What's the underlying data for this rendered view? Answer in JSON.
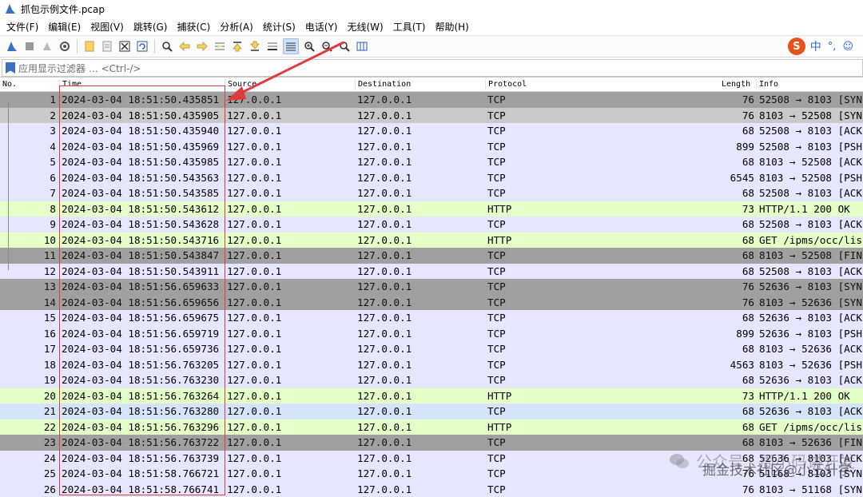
{
  "window": {
    "title": "抓包示例文件.pcap"
  },
  "menu": [
    "文件(F)",
    "编辑(E)",
    "视图(V)",
    "跳转(G)",
    "捕获(C)",
    "分析(A)",
    "统计(S)",
    "电话(Y)",
    "无线(W)",
    "工具(T)",
    "帮助(H)"
  ],
  "toolbar": {
    "icons": [
      "shark-fin-icon",
      "stop-icon",
      "restart-icon",
      "options-icon",
      "open-icon",
      "save-icon",
      "close-icon",
      "reload-icon",
      "find-icon",
      "back-icon",
      "forward-icon",
      "go-to-icon",
      "first-icon",
      "last-icon",
      "autoscroll-icon",
      "colorize-icon",
      "zoom-in-icon",
      "zoom-out-icon",
      "zoom-normal-icon",
      "resize-columns-icon"
    ]
  },
  "ime": {
    "logo": "S",
    "lang": "中",
    "punct": "°,",
    "emoji": "☺"
  },
  "filter": {
    "placeholder": "应用显示过滤器 … <Ctrl-/>"
  },
  "columns": {
    "no": "No.",
    "time": "Time",
    "source": "Source",
    "destination": "Destination",
    "protocol": "Protocol",
    "length": "Length",
    "info": "Info"
  },
  "packets": [
    {
      "no": "1",
      "time": "2024-03-04 18:51:50.435851",
      "src": "127.0.0.1",
      "dst": "127.0.0.1",
      "proto": "TCP",
      "len": "76",
      "info": "52508 → 8103 [SYN"
    },
    {
      "no": "2",
      "time": "2024-03-04 18:51:50.435905",
      "src": "127.0.0.1",
      "dst": "127.0.0.1",
      "proto": "TCP",
      "len": "76",
      "info": "8103 → 52508 [SYN"
    },
    {
      "no": "3",
      "time": "2024-03-04 18:51:50.435940",
      "src": "127.0.0.1",
      "dst": "127.0.0.1",
      "proto": "TCP",
      "len": "68",
      "info": "52508 → 8103 [ACK"
    },
    {
      "no": "4",
      "time": "2024-03-04 18:51:50.435969",
      "src": "127.0.0.1",
      "dst": "127.0.0.1",
      "proto": "TCP",
      "len": "899",
      "info": "52508 → 8103 [PSH"
    },
    {
      "no": "5",
      "time": "2024-03-04 18:51:50.435985",
      "src": "127.0.0.1",
      "dst": "127.0.0.1",
      "proto": "TCP",
      "len": "68",
      "info": "8103 → 52508 [ACK"
    },
    {
      "no": "6",
      "time": "2024-03-04 18:51:50.543563",
      "src": "127.0.0.1",
      "dst": "127.0.0.1",
      "proto": "TCP",
      "len": "6545",
      "info": "8103 → 52508 [PSH"
    },
    {
      "no": "7",
      "time": "2024-03-04 18:51:50.543585",
      "src": "127.0.0.1",
      "dst": "127.0.0.1",
      "proto": "TCP",
      "len": "68",
      "info": "52508 → 8103 [ACK"
    },
    {
      "no": "8",
      "time": "2024-03-04 18:51:50.543612",
      "src": "127.0.0.1",
      "dst": "127.0.0.1",
      "proto": "HTTP",
      "len": "73",
      "info": "HTTP/1.1 200 OK"
    },
    {
      "no": "9",
      "time": "2024-03-04 18:51:50.543628",
      "src": "127.0.0.1",
      "dst": "127.0.0.1",
      "proto": "TCP",
      "len": "68",
      "info": "52508 → 8103 [ACK"
    },
    {
      "no": "10",
      "time": "2024-03-04 18:51:50.543716",
      "src": "127.0.0.1",
      "dst": "127.0.0.1",
      "proto": "HTTP",
      "len": "68",
      "info": "GET /ipms/occ/lis"
    },
    {
      "no": "11",
      "time": "2024-03-04 18:51:50.543847",
      "src": "127.0.0.1",
      "dst": "127.0.0.1",
      "proto": "TCP",
      "len": "68",
      "info": "8103 → 52508 [FIN"
    },
    {
      "no": "12",
      "time": "2024-03-04 18:51:50.543911",
      "src": "127.0.0.1",
      "dst": "127.0.0.1",
      "proto": "TCP",
      "len": "68",
      "info": "52508 → 8103 [ACK"
    },
    {
      "no": "13",
      "time": "2024-03-04 18:51:56.659633",
      "src": "127.0.0.1",
      "dst": "127.0.0.1",
      "proto": "TCP",
      "len": "76",
      "info": "52636 → 8103 [SYN"
    },
    {
      "no": "14",
      "time": "2024-03-04 18:51:56.659656",
      "src": "127.0.0.1",
      "dst": "127.0.0.1",
      "proto": "TCP",
      "len": "76",
      "info": "8103 → 52636 [SYN"
    },
    {
      "no": "15",
      "time": "2024-03-04 18:51:56.659675",
      "src": "127.0.0.1",
      "dst": "127.0.0.1",
      "proto": "TCP",
      "len": "68",
      "info": "52636 → 8103 [ACK"
    },
    {
      "no": "16",
      "time": "2024-03-04 18:51:56.659719",
      "src": "127.0.0.1",
      "dst": "127.0.0.1",
      "proto": "TCP",
      "len": "899",
      "info": "52636 → 8103 [PSH"
    },
    {
      "no": "17",
      "time": "2024-03-04 18:51:56.659736",
      "src": "127.0.0.1",
      "dst": "127.0.0.1",
      "proto": "TCP",
      "len": "68",
      "info": "8103 → 52636 [ACK"
    },
    {
      "no": "18",
      "time": "2024-03-04 18:51:56.763205",
      "src": "127.0.0.1",
      "dst": "127.0.0.1",
      "proto": "TCP",
      "len": "4563",
      "info": "8103 → 52636 [PSH"
    },
    {
      "no": "19",
      "time": "2024-03-04 18:51:56.763230",
      "src": "127.0.0.1",
      "dst": "127.0.0.1",
      "proto": "TCP",
      "len": "68",
      "info": "52636 → 8103 [ACK"
    },
    {
      "no": "20",
      "time": "2024-03-04 18:51:56.763264",
      "src": "127.0.0.1",
      "dst": "127.0.0.1",
      "proto": "HTTP",
      "len": "73",
      "info": "HTTP/1.1 200 OK"
    },
    {
      "no": "21",
      "time": "2024-03-04 18:51:56.763280",
      "src": "127.0.0.1",
      "dst": "127.0.0.1",
      "proto": "TCP",
      "len": "68",
      "info": "52636 → 8103 [ACK"
    },
    {
      "no": "22",
      "time": "2024-03-04 18:51:56.763296",
      "src": "127.0.0.1",
      "dst": "127.0.0.1",
      "proto": "HTTP",
      "len": "68",
      "info": "GET /ipms/occ/lis"
    },
    {
      "no": "23",
      "time": "2024-03-04 18:51:56.763722",
      "src": "127.0.0.1",
      "dst": "127.0.0.1",
      "proto": "TCP",
      "len": "68",
      "info": "8103 → 52636 [FIN"
    },
    {
      "no": "24",
      "time": "2024-03-04 18:51:56.763739",
      "src": "127.0.0.1",
      "dst": "127.0.0.1",
      "proto": "TCP",
      "len": "68",
      "info": "52636 → 8103 [ACK"
    },
    {
      "no": "25",
      "time": "2024-03-04 18:51:58.766721",
      "src": "127.0.0.1",
      "dst": "127.0.0.1",
      "proto": "TCP",
      "len": "76",
      "info": "51168 → 8103 [SYN"
    },
    {
      "no": "26",
      "time": "2024-03-04 18:51:58.766741",
      "src": "127.0.0.1",
      "dst": "127.0.0.1",
      "proto": "TCP",
      "len": "76",
      "info": "8103 → 51168 [SYN"
    }
  ],
  "row_styles": [
    "dark",
    "grayrow",
    "tcp",
    "tcp",
    "tcp",
    "tcp",
    "tcp",
    "http",
    "tcp",
    "http",
    "dark",
    "tcp",
    "dark",
    "dark",
    "tcp",
    "tcp",
    "tcp",
    "tcp",
    "tcp",
    "http",
    "sel2",
    "http",
    "dark",
    "tcp",
    "tcp",
    "tcp"
  ],
  "watermark": {
    "line1": "公众号 · 周小码讲开发",
    "line2": "掘金技术社区@小王升学"
  },
  "colors": {
    "tcp": "#e7e6ff",
    "http": "#e4ffc7",
    "flag_rows": "#a0a0a0",
    "selection_box": "#e03a3a",
    "arrow": "#e03a3a"
  }
}
